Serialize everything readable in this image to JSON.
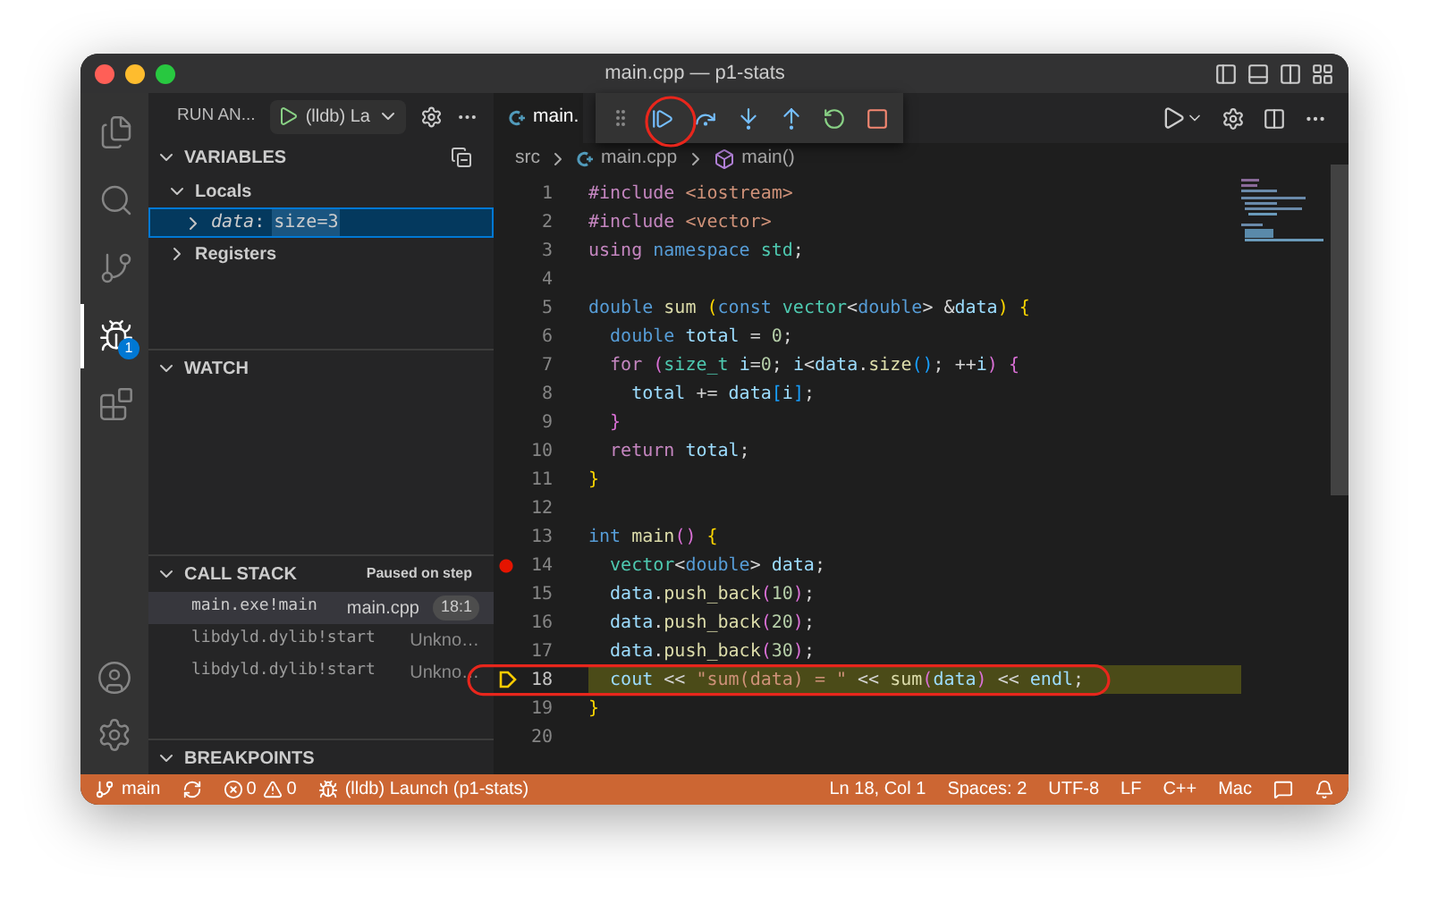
{
  "window": {
    "title": "main.cpp — p1-stats"
  },
  "activity_bar": [
    {
      "kind": "explorer",
      "selected": false
    },
    {
      "kind": "search",
      "selected": false
    },
    {
      "kind": "source_control",
      "selected": false
    },
    {
      "kind": "run_debug",
      "selected": true,
      "badge": "1"
    },
    {
      "kind": "extensions",
      "selected": false
    }
  ],
  "activity_bar_bottom": [
    {
      "kind": "account"
    },
    {
      "kind": "settings"
    }
  ],
  "sidebar": {
    "title": "RUN AN...",
    "launch_config": "(lldb) La",
    "variables": {
      "title": "VARIABLES",
      "scopes": [
        {
          "label": "Locals",
          "expanded": true,
          "children": [
            {
              "name": "data",
              "separator": ":",
              "value": "size=3",
              "selected": true,
              "expanded": false
            }
          ]
        },
        {
          "label": "Registers",
          "expanded": false
        }
      ]
    },
    "watch": {
      "title": "WATCH"
    },
    "call_stack": {
      "title": "CALL STACK",
      "status": "Paused on step",
      "frames": [
        {
          "name": "main.exe!main",
          "file": "main.cpp",
          "position": "18:1",
          "selected": true
        },
        {
          "name": "libdyld.dylib!start",
          "file": "Unkno…",
          "selected": false
        },
        {
          "name": "libdyld.dylib!start",
          "file": "Unkno…",
          "selected": false
        }
      ]
    },
    "breakpoints": {
      "title": "BREAKPOINTS"
    }
  },
  "editor": {
    "tab": "main.",
    "breadcrumb": [
      "src",
      "main.cpp",
      "main()"
    ],
    "lines": [
      {
        "number": "1",
        "breakpoint": false,
        "current": false,
        "tokens": [
          {
            "kind": "control",
            "text": "#include "
          },
          {
            "kind": "string",
            "text": "<iostream>"
          }
        ]
      },
      {
        "number": "2",
        "breakpoint": false,
        "current": false,
        "tokens": [
          {
            "kind": "control",
            "text": "#include "
          },
          {
            "kind": "string",
            "text": "<vector>"
          }
        ]
      },
      {
        "number": "3",
        "breakpoint": false,
        "current": false,
        "tokens": [
          {
            "kind": "control",
            "text": "using "
          },
          {
            "kind": "keyword",
            "text": "namespace "
          },
          {
            "kind": "type",
            "text": "std"
          },
          {
            "kind": "plain",
            "text": ";"
          }
        ]
      },
      {
        "number": "4",
        "breakpoint": false,
        "current": false
      },
      {
        "number": "5",
        "breakpoint": false,
        "current": false,
        "tokens": [
          {
            "kind": "keyword",
            "text": "double "
          },
          {
            "kind": "func",
            "text": "sum "
          },
          {
            "kind": "bracket",
            "text": "("
          },
          {
            "kind": "keyword",
            "text": "const "
          },
          {
            "kind": "type",
            "text": "vector"
          },
          {
            "kind": "plain",
            "text": "<"
          },
          {
            "kind": "keyword",
            "text": "double"
          },
          {
            "kind": "plain",
            "text": "> &"
          },
          {
            "kind": "var",
            "text": "data"
          },
          {
            "kind": "bracket",
            "text": ") {"
          }
        ]
      },
      {
        "number": "6",
        "breakpoint": false,
        "current": false,
        "tokens": [
          {
            "kind": "keyword",
            "text": "  double "
          },
          {
            "kind": "var",
            "text": "total "
          },
          {
            "kind": "plain",
            "text": "= "
          },
          {
            "kind": "num",
            "text": "0"
          },
          {
            "kind": "plain",
            "text": ";"
          }
        ]
      },
      {
        "number": "7",
        "breakpoint": false,
        "current": false,
        "tokens": [
          {
            "kind": "control",
            "text": "  for "
          },
          {
            "kind": "bracket2",
            "text": "("
          },
          {
            "kind": "type",
            "text": "size_t "
          },
          {
            "kind": "var",
            "text": "i"
          },
          {
            "kind": "plain",
            "text": "="
          },
          {
            "kind": "num",
            "text": "0"
          },
          {
            "kind": "plain",
            "text": "; "
          },
          {
            "kind": "var",
            "text": "i"
          },
          {
            "kind": "plain",
            "text": "<"
          },
          {
            "kind": "var",
            "text": "data"
          },
          {
            "kind": "plain",
            "text": "."
          },
          {
            "kind": "func",
            "text": "size"
          },
          {
            "kind": "bracket3",
            "text": "()"
          },
          {
            "kind": "plain",
            "text": "; ++"
          },
          {
            "kind": "var",
            "text": "i"
          },
          {
            "kind": "bracket2",
            "text": ") {"
          }
        ]
      },
      {
        "number": "8",
        "breakpoint": false,
        "current": false,
        "tokens": [
          {
            "kind": "var",
            "text": "    total "
          },
          {
            "kind": "plain",
            "text": "+= "
          },
          {
            "kind": "var",
            "text": "data"
          },
          {
            "kind": "bracket3",
            "text": "["
          },
          {
            "kind": "var",
            "text": "i"
          },
          {
            "kind": "bracket3",
            "text": "]"
          },
          {
            "kind": "plain",
            "text": ";"
          }
        ]
      },
      {
        "number": "9",
        "breakpoint": false,
        "current": false,
        "tokens": [
          {
            "kind": "bracket2",
            "text": "  }"
          }
        ]
      },
      {
        "number": "10",
        "breakpoint": false,
        "current": false,
        "tokens": [
          {
            "kind": "control",
            "text": "  return "
          },
          {
            "kind": "var",
            "text": "total"
          },
          {
            "kind": "plain",
            "text": ";"
          }
        ]
      },
      {
        "number": "11",
        "breakpoint": false,
        "current": false,
        "tokens": [
          {
            "kind": "bracket",
            "text": "}"
          }
        ]
      },
      {
        "number": "12",
        "breakpoint": false,
        "current": false
      },
      {
        "number": "13",
        "breakpoint": false,
        "current": false,
        "tokens": [
          {
            "kind": "keyword",
            "text": "int "
          },
          {
            "kind": "func",
            "text": "main"
          },
          {
            "kind": "bracket2",
            "text": "()"
          },
          {
            "kind": "bracket",
            "text": " {"
          }
        ]
      },
      {
        "number": "14",
        "breakpoint": true,
        "current": false,
        "tokens": [
          {
            "kind": "type",
            "text": "  vector"
          },
          {
            "kind": "plain",
            "text": "<"
          },
          {
            "kind": "keyword",
            "text": "double"
          },
          {
            "kind": "plain",
            "text": "> "
          },
          {
            "kind": "var",
            "text": "data"
          },
          {
            "kind": "plain",
            "text": ";"
          }
        ]
      },
      {
        "number": "15",
        "breakpoint": false,
        "current": false,
        "tokens": [
          {
            "kind": "var",
            "text": "  data"
          },
          {
            "kind": "plain",
            "text": "."
          },
          {
            "kind": "func",
            "text": "push_back"
          },
          {
            "kind": "bracket2",
            "text": "("
          },
          {
            "kind": "num",
            "text": "10"
          },
          {
            "kind": "bracket2",
            "text": ")"
          },
          {
            "kind": "plain",
            "text": ";"
          }
        ]
      },
      {
        "number": "16",
        "breakpoint": false,
        "current": false,
        "tokens": [
          {
            "kind": "var",
            "text": "  data"
          },
          {
            "kind": "plain",
            "text": "."
          },
          {
            "kind": "func",
            "text": "push_back"
          },
          {
            "kind": "bracket2",
            "text": "("
          },
          {
            "kind": "num",
            "text": "20"
          },
          {
            "kind": "bracket2",
            "text": ")"
          },
          {
            "kind": "plain",
            "text": ";"
          }
        ]
      },
      {
        "number": "17",
        "breakpoint": false,
        "current": false,
        "tokens": [
          {
            "kind": "var",
            "text": "  data"
          },
          {
            "kind": "plain",
            "text": "."
          },
          {
            "kind": "func",
            "text": "push_back"
          },
          {
            "kind": "bracket2",
            "text": "("
          },
          {
            "kind": "num",
            "text": "30"
          },
          {
            "kind": "bracket2",
            "text": ")"
          },
          {
            "kind": "plain",
            "text": ";"
          }
        ]
      },
      {
        "number": "18",
        "breakpoint": false,
        "current": true,
        "tokens": [
          {
            "kind": "var",
            "text": "  cout "
          },
          {
            "kind": "plain",
            "text": "<< "
          },
          {
            "kind": "string",
            "text": "\"sum(data) = \" "
          },
          {
            "kind": "plain",
            "text": "<< "
          },
          {
            "kind": "func",
            "text": "sum"
          },
          {
            "kind": "bracket2",
            "text": "("
          },
          {
            "kind": "var",
            "text": "data"
          },
          {
            "kind": "bracket2",
            "text": ")"
          },
          {
            "kind": "plain",
            "text": " << "
          },
          {
            "kind": "var",
            "text": "endl"
          },
          {
            "kind": "plain",
            "text": ";"
          }
        ]
      },
      {
        "number": "19",
        "breakpoint": false,
        "current": false,
        "tokens": [
          {
            "kind": "bracket",
            "text": "}"
          }
        ]
      },
      {
        "number": "20",
        "breakpoint": false,
        "current": false
      }
    ]
  },
  "status_bar": {
    "left": [
      {
        "kind": "branch",
        "text": "main"
      },
      {
        "kind": "sync"
      },
      {
        "kind": "errors",
        "text": "0"
      },
      {
        "kind": "warnings",
        "text": "0"
      },
      {
        "kind": "debug",
        "text": "(lldb) Launch (p1-stats)"
      }
    ],
    "right": [
      {
        "kind": "text",
        "text": "Ln 18, Col 1"
      },
      {
        "kind": "text",
        "text": "Spaces: 2"
      },
      {
        "kind": "text",
        "text": "UTF-8"
      },
      {
        "kind": "text",
        "text": "LF"
      },
      {
        "kind": "text",
        "text": "C++"
      },
      {
        "kind": "text",
        "text": "Mac"
      },
      {
        "kind": "feedback"
      },
      {
        "kind": "bell"
      }
    ]
  }
}
